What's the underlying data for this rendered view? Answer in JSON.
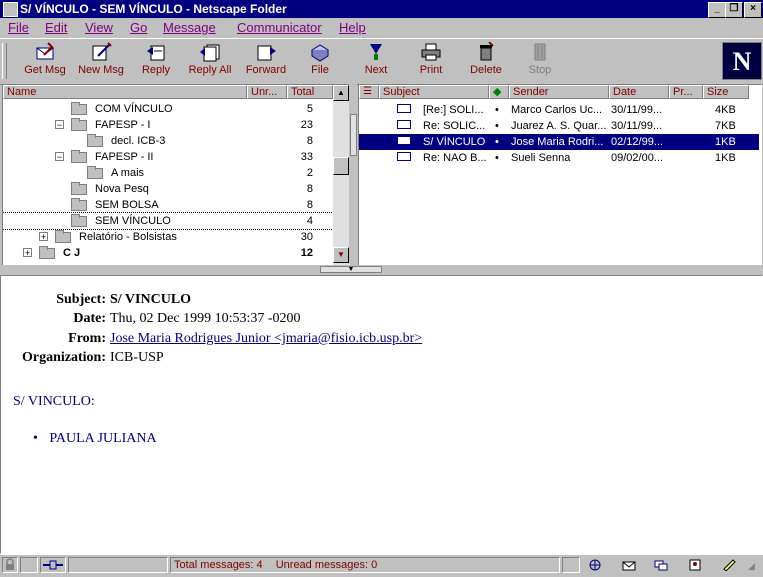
{
  "window": {
    "title": "S/ VÍNCULO - SEM VÍNCULO - Netscape Folder"
  },
  "menu": [
    "File",
    "Edit",
    "View",
    "Go",
    "Message",
    "Communicator",
    "Help"
  ],
  "toolbar": {
    "buttons": [
      {
        "label": "Get Msg",
        "icon": "get-msg-icon"
      },
      {
        "label": "New Msg",
        "icon": "new-msg-icon"
      },
      {
        "label": "Reply",
        "icon": "reply-icon"
      },
      {
        "label": "Reply All",
        "icon": "reply-all-icon"
      },
      {
        "label": "Forward",
        "icon": "forward-icon"
      },
      {
        "label": "File",
        "icon": "file-icon"
      },
      {
        "label": "Next",
        "icon": "next-icon"
      },
      {
        "label": "Print",
        "icon": "print-icon"
      },
      {
        "label": "Delete",
        "icon": "delete-icon"
      },
      {
        "label": "Stop",
        "icon": "stop-icon"
      }
    ]
  },
  "folders": {
    "columns": {
      "name": "Name",
      "unread": "Unr...",
      "total": "Total"
    },
    "rows": [
      {
        "name": "COM VÍNCULO",
        "total": "5"
      },
      {
        "name": "FAPESP - I",
        "total": "23"
      },
      {
        "name": "decl. ICB-3",
        "total": "8"
      },
      {
        "name": "FAPESP - II",
        "total": "33"
      },
      {
        "name": "A mais",
        "total": "2"
      },
      {
        "name": "Nova Pesq",
        "total": "8"
      },
      {
        "name": "SEM BOLSA",
        "total": "8"
      },
      {
        "name": "SEM VÍNCULO",
        "total": "4"
      },
      {
        "name": "Relatório - Bolsistas",
        "total": "30"
      },
      {
        "name": "C J",
        "total": "12"
      }
    ]
  },
  "messages": {
    "columns": {
      "subject": "Subject",
      "sender": "Sender",
      "date": "Date",
      "priority": "Pr...",
      "size": "Size"
    },
    "rows": [
      {
        "subject": "[Re:] SOLI...",
        "sender": "Marco Carlos Uc...",
        "date": "30/11/99...",
        "size": "4KB"
      },
      {
        "subject": "Re: SOLIC...",
        "sender": "Juarez A. S. Quar...",
        "date": "30/11/99...",
        "size": "7KB"
      },
      {
        "subject": "S/ VÍNCULO",
        "sender": "Jose Maria Rodri...",
        "date": "02/12/99...",
        "size": "1KB"
      },
      {
        "subject": "Re: NAO B...",
        "sender": "Sueli Senna",
        "date": "09/02/00...",
        "size": "1KB"
      }
    ]
  },
  "message": {
    "labels": {
      "subject": "Subject:",
      "date": "Date:",
      "from": "From:",
      "organization": "Organization:"
    },
    "subject": "S/ VINCULO",
    "date": "Thu, 02 Dec 1999 10:53:37 -0200",
    "from": "Jose Maria Rodrigues Junior <jmaria@fisio.icb.usp.br>",
    "organization": "ICB-USP",
    "body_heading": "S/ VINCULO:",
    "body_items": [
      "PAULA JULIANA"
    ]
  },
  "status": {
    "total": "Total messages: 4",
    "unread": "Unread messages: 0"
  }
}
